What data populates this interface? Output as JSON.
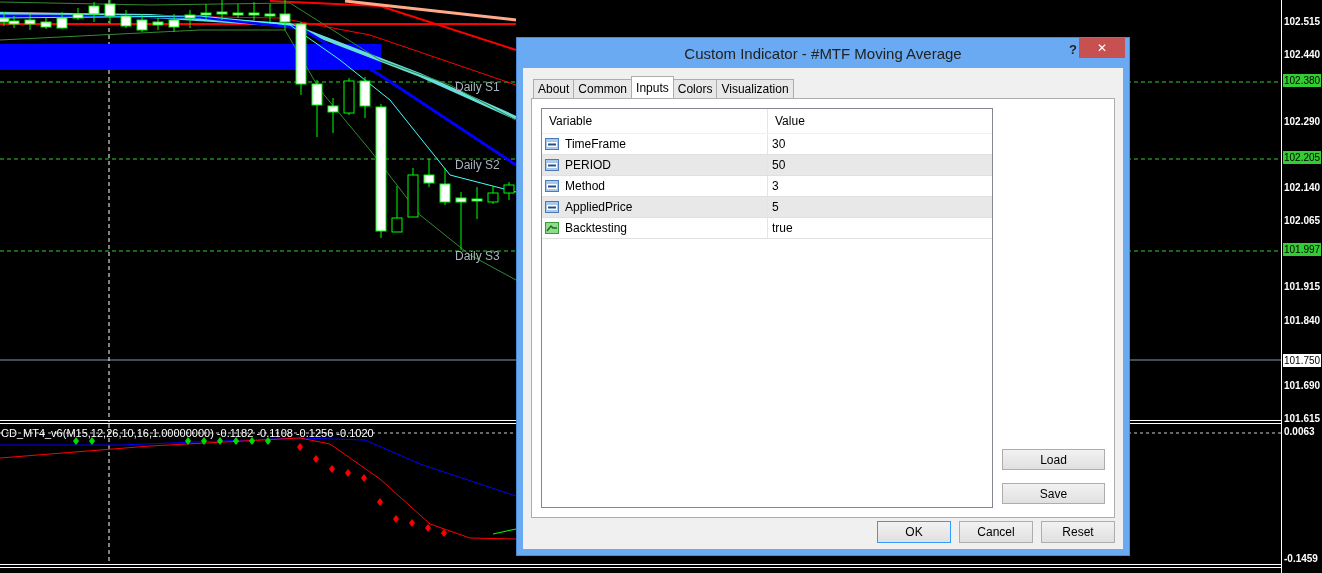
{
  "chart": {
    "level_labels": [
      "Daily S1",
      "Daily S2",
      "Daily S3"
    ],
    "price_axis": [
      {
        "text": "102.515",
        "kind": "tick"
      },
      {
        "text": "102.440",
        "kind": "tick"
      },
      {
        "text": "102.380",
        "kind": "tag",
        "color": "#33cc33"
      },
      {
        "text": "102.290",
        "kind": "tick"
      },
      {
        "text": "102.205",
        "kind": "tag",
        "color": "#33cc33"
      },
      {
        "text": "102.140",
        "kind": "tick"
      },
      {
        "text": "102.065",
        "kind": "tick"
      },
      {
        "text": "101.997",
        "kind": "tag",
        "color": "#33cc33"
      },
      {
        "text": "101.915",
        "kind": "tick"
      },
      {
        "text": "101.840",
        "kind": "tick"
      },
      {
        "text": "101.750",
        "kind": "tag",
        "color": "#ffffff"
      },
      {
        "text": "101.690",
        "kind": "tick"
      },
      {
        "text": "101.615",
        "kind": "tick"
      }
    ]
  },
  "indicator": {
    "label": "CD_MT4_v6(M15,12,26,10,16,1.00000000) -0.1182 -0.1108 -0.1256 -0.1020",
    "axis": [
      {
        "text": "0.0063",
        "kind": "tick"
      },
      {
        "text": "-0.1459",
        "kind": "tick"
      }
    ]
  },
  "dialog": {
    "title": "Custom Indicator - #MTF Moving Average",
    "help": "?",
    "close": "✕",
    "tabs": [
      {
        "label": "About",
        "selected": false
      },
      {
        "label": "Common",
        "selected": false
      },
      {
        "label": "Inputs",
        "selected": true
      },
      {
        "label": "Colors",
        "selected": false
      },
      {
        "label": "Visualization",
        "selected": false
      }
    ],
    "columns": [
      "Variable",
      "Value"
    ],
    "rows": [
      {
        "kind": "int",
        "variable": "TimeFrame",
        "value": "30"
      },
      {
        "kind": "int",
        "variable": "PERIOD",
        "value": "50"
      },
      {
        "kind": "int",
        "variable": "Method",
        "value": "3"
      },
      {
        "kind": "int",
        "variable": "AppliedPrice",
        "value": "5"
      },
      {
        "kind": "bool",
        "variable": "Backtesting",
        "value": "true"
      }
    ],
    "side_buttons": [
      "Load",
      "Save"
    ],
    "buttons": [
      {
        "label": "OK",
        "default": true
      },
      {
        "label": "Cancel",
        "default": false
      },
      {
        "label": "Reset",
        "default": false
      }
    ]
  }
}
